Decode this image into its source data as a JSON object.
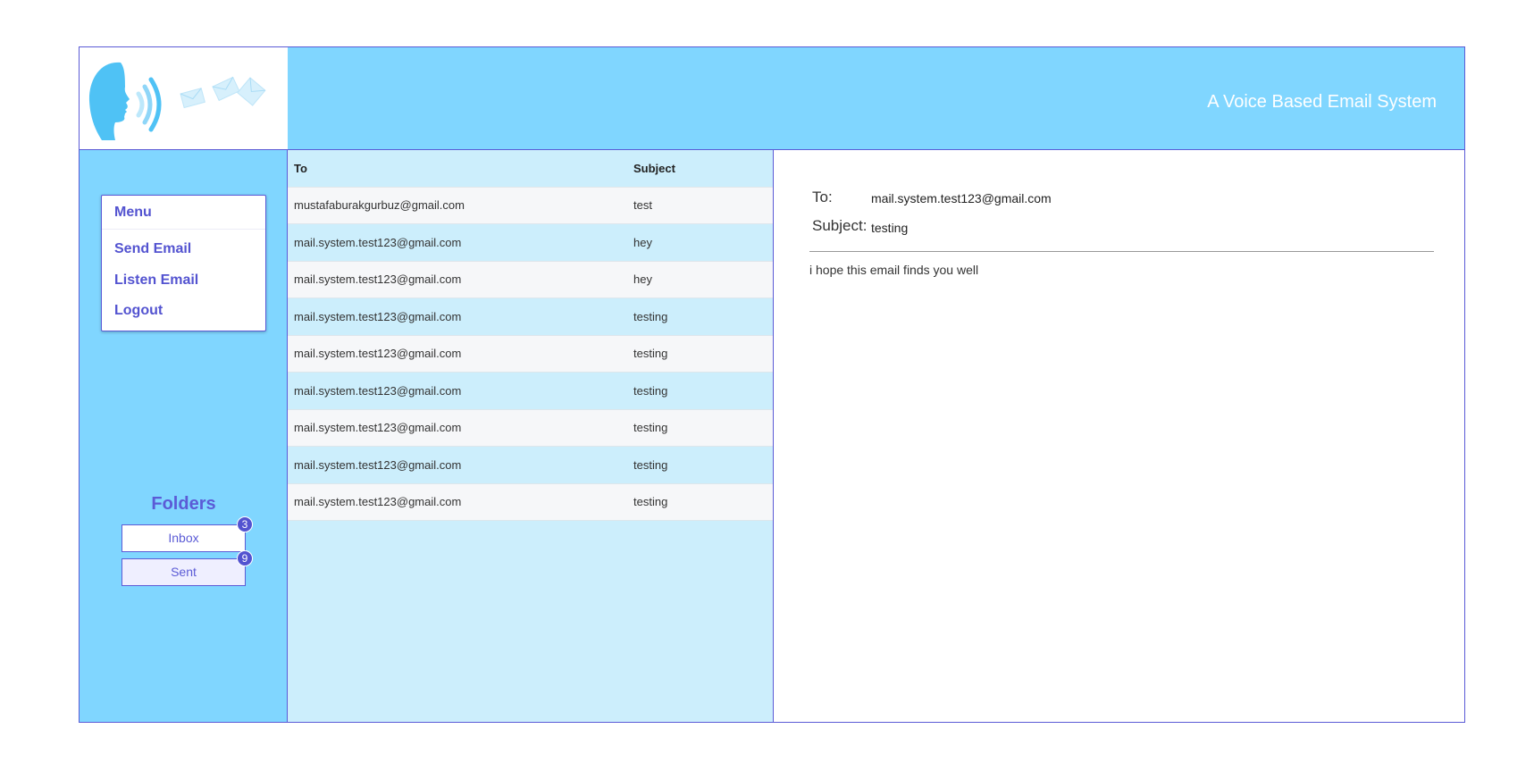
{
  "header": {
    "title": "A Voice Based Email System",
    "logo_icon": "voice-mail-logo-icon"
  },
  "sidebar": {
    "menu": {
      "title": "Menu",
      "items": [
        {
          "label": "Send Email"
        },
        {
          "label": "Listen Email"
        },
        {
          "label": "Logout"
        }
      ]
    },
    "folders": {
      "title": "Folders",
      "items": [
        {
          "label": "Inbox",
          "count": "3"
        },
        {
          "label": "Sent",
          "count": "9"
        }
      ]
    }
  },
  "mail_list": {
    "columns": [
      "To",
      "Subject"
    ],
    "rows": [
      {
        "to": "mustafaburakgurbuz@gmail.com",
        "subject": "test"
      },
      {
        "to": "mail.system.test123@gmail.com",
        "subject": "hey"
      },
      {
        "to": "mail.system.test123@gmail.com",
        "subject": "hey"
      },
      {
        "to": "mail.system.test123@gmail.com",
        "subject": "testing"
      },
      {
        "to": "mail.system.test123@gmail.com",
        "subject": "testing"
      },
      {
        "to": "mail.system.test123@gmail.com",
        "subject": "testing"
      },
      {
        "to": "mail.system.test123@gmail.com",
        "subject": "testing"
      },
      {
        "to": "mail.system.test123@gmail.com",
        "subject": "testing"
      },
      {
        "to": "mail.system.test123@gmail.com",
        "subject": "testing"
      }
    ]
  },
  "detail": {
    "to_label": "To:",
    "to_value": "mail.system.test123@gmail.com",
    "subject_label": "Subject:",
    "subject_value": "testing",
    "body": "i hope this email finds you well"
  },
  "colors": {
    "accent": "#5b5bd6",
    "header_bg": "#80d6ff",
    "list_bg": "#cceefc"
  }
}
